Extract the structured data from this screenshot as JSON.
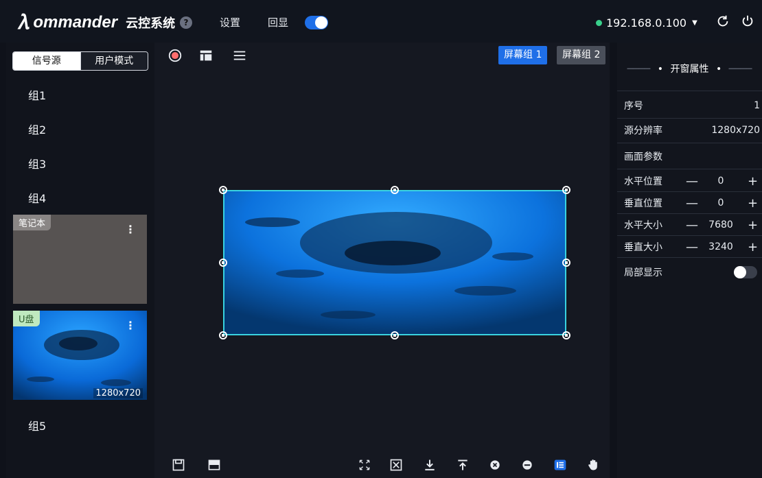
{
  "topbar": {
    "logo_mark": "𝜆",
    "logo_text": "ommander",
    "logo_cn": "云控系统",
    "help": "?",
    "settings_label": "设置",
    "echo_label": "回显",
    "echo_toggle_on": true,
    "ip": "192.168.0.100"
  },
  "left": {
    "tabs": [
      "信号源",
      "用户模式"
    ],
    "groups": [
      "组1",
      "组2",
      "组3",
      "组4",
      "组5"
    ],
    "cards": [
      {
        "tag": "笔记本",
        "menu": "⋮"
      },
      {
        "tag": "U盘",
        "menu": "⋮",
        "resolution": "1280x720"
      }
    ]
  },
  "center": {
    "screen_groups": [
      "屏幕组 1",
      "屏幕组 2"
    ],
    "active_screen_group": 0
  },
  "right": {
    "header": "开窗属性",
    "rows": [
      {
        "label": "序号",
        "value": "1"
      },
      {
        "label": "源分辨率",
        "value": "1280x720"
      },
      {
        "label": "画面参数"
      }
    ],
    "steppers": [
      {
        "label": "水平位置",
        "value": "0"
      },
      {
        "label": "垂直位置",
        "value": "0"
      },
      {
        "label": "水平大小",
        "value": "7680"
      },
      {
        "label": "垂直大小",
        "value": "3240"
      }
    ],
    "partial_display_label": "局部显示",
    "partial_display_on": false
  },
  "colors": {
    "accent": "#1f6fe8",
    "selection": "#39d3e0",
    "online": "#39d08b"
  }
}
